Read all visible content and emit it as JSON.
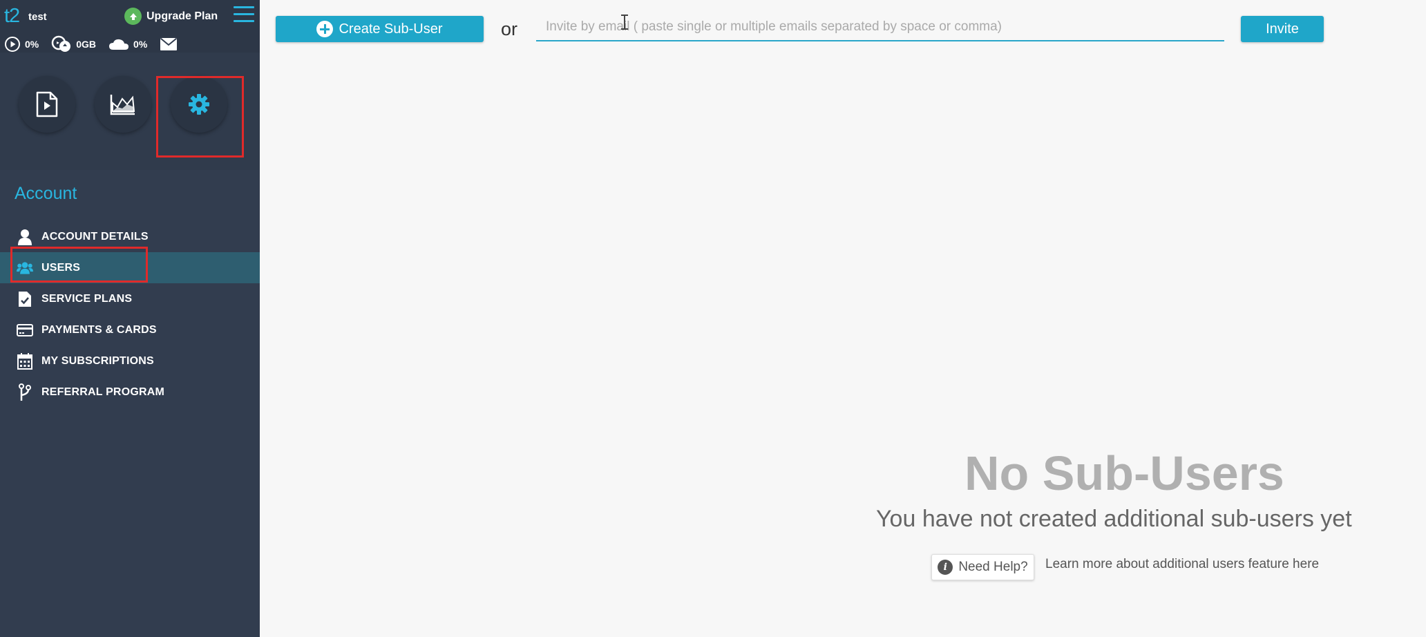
{
  "app": {
    "logo": "t2",
    "username": "test",
    "upgrade_label": "Upgrade Plan",
    "stats": {
      "playback": "0%",
      "storage": "0GB",
      "cloud": "0%"
    }
  },
  "sidebar": {
    "section_title": "Account",
    "items": [
      {
        "label": "ACCOUNT DETAILS",
        "icon": "user-icon",
        "active": false
      },
      {
        "label": "USERS",
        "icon": "users-icon",
        "active": true
      },
      {
        "label": "SERVICE PLANS",
        "icon": "document-check-icon",
        "active": false
      },
      {
        "label": "PAYMENTS & CARDS",
        "icon": "credit-card-icon",
        "active": false
      },
      {
        "label": "MY SUBSCRIPTIONS",
        "icon": "calendar-icon",
        "active": false
      },
      {
        "label": "REFERRAL PROGRAM",
        "icon": "branch-icon",
        "active": false
      }
    ]
  },
  "toolbar": {
    "create_label": "Create Sub-User",
    "or_text": "or",
    "invite_placeholder": "Invite by email ( paste single or multiple emails separated by space or comma)",
    "invite_value": "",
    "invite_label": "Invite"
  },
  "empty_state": {
    "title": "No Sub-Users",
    "subtitle": "You have not created additional sub-users yet",
    "help_label": "Need Help?",
    "help_link": "Learn more about additional users feature here"
  },
  "colors": {
    "sidebar_bg": "#323d4f",
    "accent": "#1fa6c9",
    "highlight": "#e02a2a",
    "upgrade_green": "#5cb85c"
  }
}
